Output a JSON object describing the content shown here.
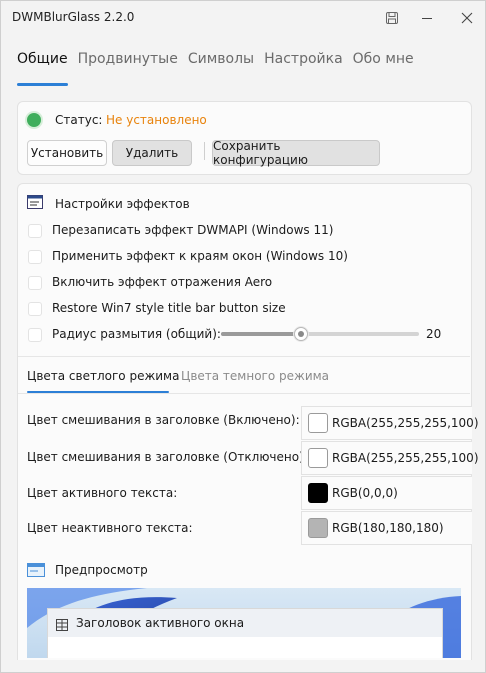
{
  "window": {
    "title": "DWMBlurGlass 2.2.0"
  },
  "tabs": [
    "Общие",
    "Продвинутые",
    "Символы",
    "Настройка",
    "Обо мне"
  ],
  "status": {
    "label": "Статус:",
    "value": "Не установлено",
    "value_color": "#e8830c"
  },
  "buttons": {
    "install": "Установить",
    "remove": "Удалить",
    "save": "Сохранить конфигурацию"
  },
  "effects": {
    "heading": "Настройки эффектов",
    "options": [
      "Перезаписать эффект DWMAPI (Windows 11)",
      "Применить эффект к краям окон (Windows 10)",
      "Включить эффект отражения Aero",
      "Restore Win7 style title bar button size"
    ],
    "blur_label": "Радиус размытия (общий):",
    "blur_value": "20",
    "blur_fraction": 0.4
  },
  "color_tabs": {
    "light": "Цвета светлого режима",
    "dark": "Цвета темного режима"
  },
  "colors": [
    {
      "label": "Цвет смешивания в заголовке (Включено):",
      "value": "RGBA(255,255,255,100)",
      "swatch": "#ffffff"
    },
    {
      "label": "Цвет смешивания в заголовке (Отключено):",
      "value": "RGBA(255,255,255,100)",
      "swatch": "#ffffff"
    },
    {
      "label": "Цвет активного текста:",
      "value": "RGB(0,0,0)",
      "swatch": "#000000"
    },
    {
      "label": "Цвет неактивного текста:",
      "value": "RGB(180,180,180)",
      "swatch": "#b4b4b4"
    }
  ],
  "preview": {
    "heading": "Предпросмотр",
    "window_title": "Заголовок активного окна"
  },
  "accent_color": "#2c7fd6"
}
